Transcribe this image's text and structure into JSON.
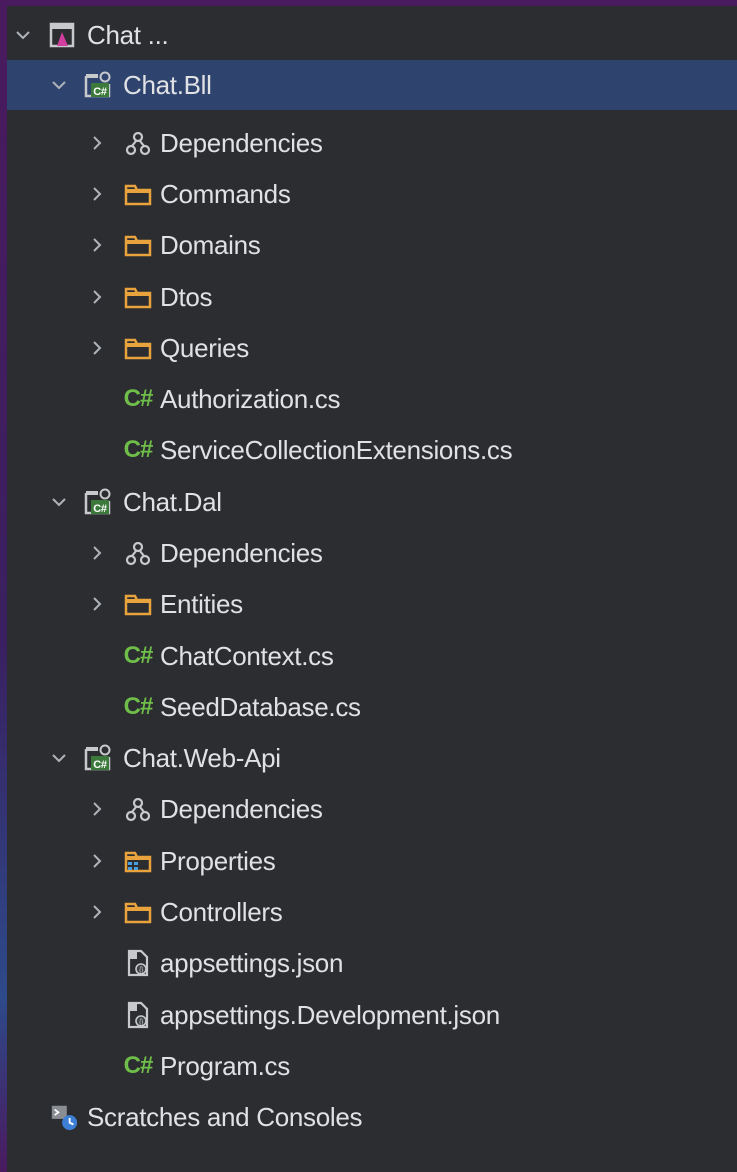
{
  "project_tree": {
    "root": {
      "label": "Chat ...",
      "icon": "solution-icon"
    },
    "bll": {
      "label": "Chat.Bll",
      "icon": "csharp-project-icon",
      "children": {
        "dependencies": "Dependencies",
        "commands": "Commands",
        "domains": "Domains",
        "dtos": "Dtos",
        "queries": "Queries",
        "authorization": "Authorization.cs",
        "service_collection_extensions": "ServiceCollectionExtensions.cs"
      }
    },
    "dal": {
      "label": "Chat.Dal",
      "icon": "csharp-project-icon",
      "children": {
        "dependencies": "Dependencies",
        "entities": "Entities",
        "chat_context": "ChatContext.cs",
        "seed_database": "SeedDatabase.cs"
      }
    },
    "web_api": {
      "label": "Chat.Web-Api",
      "icon": "csharp-project-icon",
      "children": {
        "dependencies": "Dependencies",
        "properties": "Properties",
        "controllers": "Controllers",
        "appsettings": "appsettings.json",
        "appsettings_dev": "appsettings.Development.json",
        "program": "Program.cs"
      }
    },
    "scratches": {
      "label": "Scratches and Consoles",
      "icon": "scratches-icon"
    }
  },
  "icons": {
    "csharp_glyph": "C#"
  },
  "colors": {
    "background": "#2b2d30",
    "selection": "#2e436e",
    "text": "#dfe1e5",
    "folder": "#e8a33d",
    "csharp": "#6fbe4a"
  }
}
